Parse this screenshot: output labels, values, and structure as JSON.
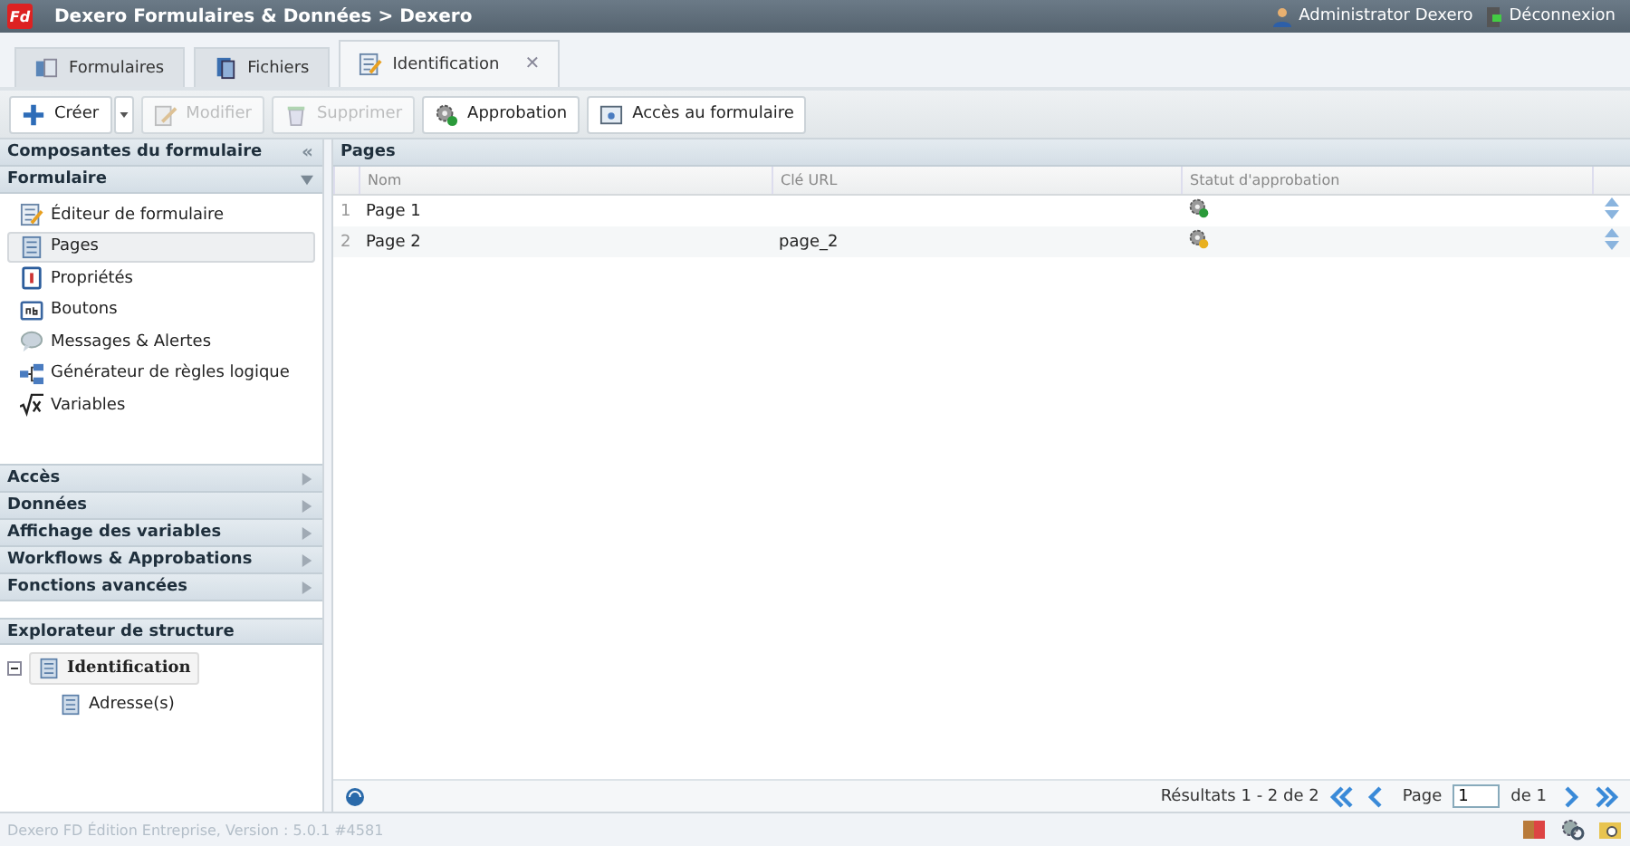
{
  "header": {
    "logo": "Fd",
    "title": "Dexero Formulaires & Données > Dexero",
    "user": "Administrator Dexero",
    "logout": "Déconnexion"
  },
  "tabs": [
    {
      "label": "Formulaires",
      "kind": "forms",
      "selected": false,
      "closable": false
    },
    {
      "label": "Fichiers",
      "kind": "files",
      "selected": false,
      "closable": false
    },
    {
      "label": "Identification",
      "kind": "editor",
      "selected": true,
      "closable": true,
      "close_glyph": "✕"
    }
  ],
  "toolbar": [
    {
      "label": "Créer",
      "kind": "plus",
      "disabled": false,
      "dropdown": true
    },
    {
      "label": "Modifier",
      "kind": "edit",
      "disabled": true,
      "dropdown": false
    },
    {
      "label": "Supprimer",
      "kind": "trash",
      "disabled": true,
      "dropdown": false
    },
    {
      "label": "Approbation",
      "kind": "gear",
      "disabled": false,
      "dropdown": false
    },
    {
      "label": "Accès au formulaire",
      "kind": "window",
      "disabled": false,
      "dropdown": false
    }
  ],
  "sidebar": {
    "title": "Composantes du formulaire",
    "collapse_glyph": "«",
    "sections": [
      {
        "label": "Formulaire",
        "expanded": true,
        "items": [
          {
            "label": "Éditeur de formulaire",
            "kind": "editor",
            "selected": false
          },
          {
            "label": "Pages",
            "kind": "page",
            "selected": true
          },
          {
            "label": "Propriétés",
            "kind": "clipboard",
            "selected": false
          },
          {
            "label": "Boutons",
            "kind": "ab",
            "selected": false
          },
          {
            "label": "Messages & Alertes",
            "kind": "bubble",
            "selected": false
          },
          {
            "label": "Générateur de règles logique",
            "kind": "flow",
            "selected": false
          },
          {
            "label": "Variables",
            "kind": "sqrt",
            "selected": false
          }
        ]
      },
      {
        "label": "Accès",
        "expanded": false
      },
      {
        "label": "Données",
        "expanded": false
      },
      {
        "label": "Affichage des variables",
        "expanded": false
      },
      {
        "label": "Workflows & Approbations",
        "expanded": false
      },
      {
        "label": "Fonctions avancées",
        "expanded": false
      }
    ]
  },
  "explorer": {
    "title": "Explorateur de structure",
    "tree": [
      {
        "label": "Identification",
        "selected": true,
        "expanded": true,
        "children": [
          {
            "label": "Adresse(s)",
            "selected": false
          }
        ]
      }
    ]
  },
  "grid": {
    "title": "Pages",
    "columns": [
      "Nom",
      "Clé URL",
      "Statut d'approbation"
    ],
    "rows": [
      {
        "number": "1",
        "name": "Page 1",
        "approved": true
      },
      {
        "number": "2",
        "name": "Page 2",
        "url_key": "page_2",
        "approved": false
      }
    ]
  },
  "pagination": {
    "results": "Résultats 1 - 2 de 2",
    "page_label": "Page",
    "page": "1",
    "of": "de 1"
  },
  "footer": {
    "version": "Dexero FD Édition Entreprise, Version : 5.0.1 #4581"
  }
}
